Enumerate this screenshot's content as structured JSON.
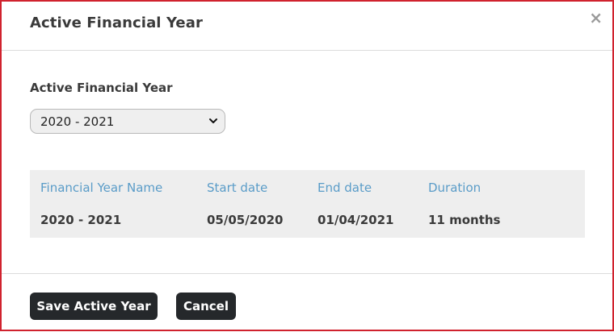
{
  "dialog": {
    "title": "Active Financial Year",
    "close_icon": "close-icon"
  },
  "form": {
    "label": "Active Financial Year",
    "select": {
      "selected": "2020 - 2021"
    }
  },
  "table": {
    "headers": [
      "Financial Year Name",
      "Start date",
      "End date",
      "Duration"
    ],
    "row": [
      "2020 - 2021",
      "05/05/2020",
      "01/04/2021",
      "11 months"
    ]
  },
  "footer": {
    "save_label": "Save Active Year",
    "cancel_label": "Cancel"
  },
  "colors": {
    "border": "#d0222e",
    "header_text": "#5a9cc8",
    "button_bg": "#25282b"
  }
}
